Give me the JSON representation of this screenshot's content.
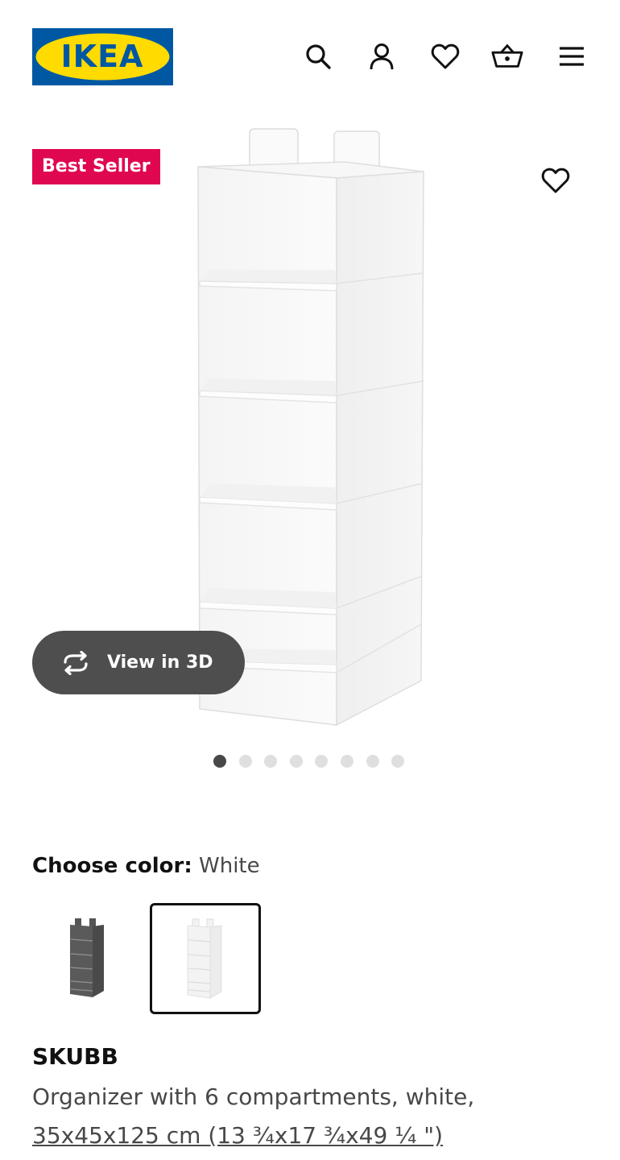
{
  "header": {
    "logo_text": "IKEA",
    "icons": [
      "search-icon",
      "account-icon",
      "heart-icon",
      "cart-icon",
      "menu-icon"
    ]
  },
  "gallery": {
    "badge": "Best Seller",
    "view_3d_label": "View in 3D",
    "image_count": 8,
    "active_image": 1
  },
  "colors": {
    "label": "Choose color:",
    "selected": "White",
    "options": [
      "dark grey",
      "white"
    ]
  },
  "product": {
    "name": "SKUBB",
    "description": "Organizer with 6 compartments, white,",
    "dimensions": "35x45x125 cm (13 ¾x17 ¾x49 ¼ \")"
  },
  "theme": {
    "brand_blue": "#0058a3",
    "brand_yellow": "#ffdb00",
    "badge_red": "#e00751"
  }
}
